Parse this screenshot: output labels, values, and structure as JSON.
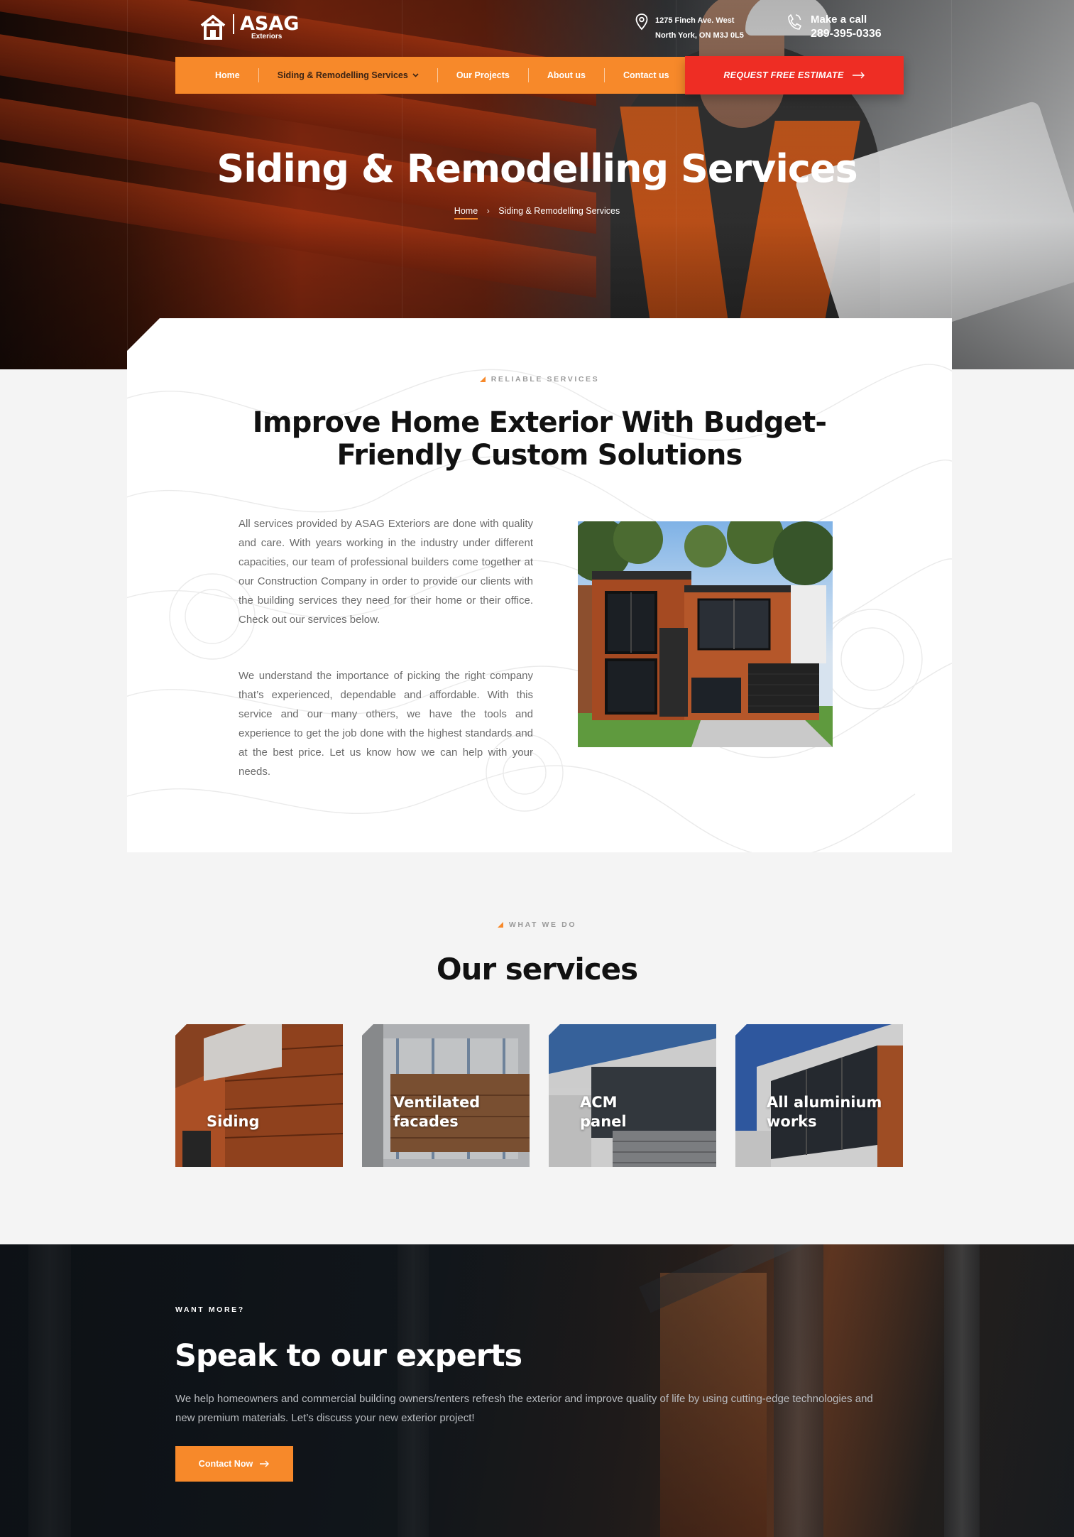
{
  "brand": {
    "name": "ASAG",
    "sub": "Exteriors"
  },
  "header": {
    "address_line1": "1275 Finch Ave. West",
    "address_line2": "North York, ON M3J 0L5",
    "call_label": "Make a call",
    "call_number": "289-395-0336"
  },
  "nav": {
    "items": [
      {
        "label": "Home"
      },
      {
        "label": "Siding & Remodelling Services"
      },
      {
        "label": "Our Projects"
      },
      {
        "label": "About us"
      },
      {
        "label": "Contact us"
      }
    ],
    "cta": "REQUEST FREE ESTIMATE"
  },
  "hero": {
    "title": "Siding & Remodelling Services",
    "breadcrumb": {
      "home": "Home",
      "current": "Siding & Remodelling Services"
    }
  },
  "intro": {
    "eyebrow": "RELIABLE SERVICES",
    "heading_line1": "Improve Home Exterior With Budget-",
    "heading_line2": "Friendly Custom Solutions",
    "paragraph1": "All services provided by ASAG Exteriors are done with quality and care. With years working in the industry under different capacities, our team of professional builders come together at our Construction Company in order to provide our clients with the building services they need for their home or their office. Check out our services below.",
    "paragraph2": "We understand the importance of picking the right company that’s experienced, dependable and affordable. With this service and our many others, we have the tools and experience to get the job done with the highest standards and at the best price. Let us know how we can help with your needs."
  },
  "services": {
    "eyebrow": "WHAT WE DO",
    "title": "Our services",
    "cards": [
      {
        "line1": "Siding",
        "line2": ""
      },
      {
        "line1": "Ventilated",
        "line2": "facades"
      },
      {
        "line1": "ACM",
        "line2": "panel"
      },
      {
        "line1": "All aluminium",
        "line2": "works"
      }
    ]
  },
  "cta": {
    "kicker": "WANT MORE?",
    "title": "Speak to our experts",
    "text": "We help homeowners and commercial building owners/renters refresh the exterior and improve quality of life by using cutting-edge technologies and new premium materials. Let’s discuss your new exterior project!",
    "button": "Contact Now"
  },
  "colors": {
    "accent": "#f7892a",
    "cta_red": "#ee2d24",
    "dark": "#111111"
  },
  "icons": [
    "house-logo-icon",
    "location-pin-icon",
    "phone-icon",
    "chevron-down-icon",
    "arrow-right-icon"
  ]
}
